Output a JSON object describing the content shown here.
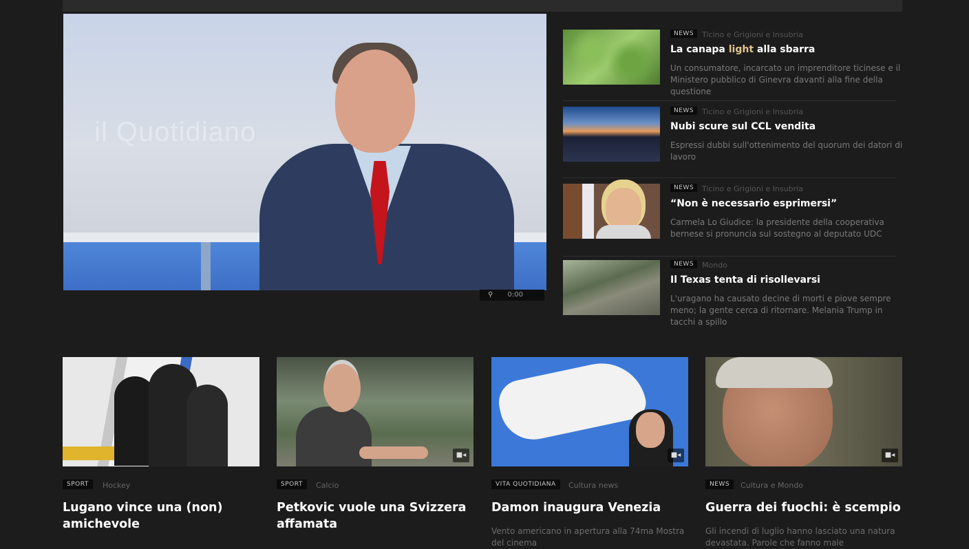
{
  "hero": {
    "studio_logo": "il Quotidiano",
    "player_label": "0:00"
  },
  "side_news": [
    {
      "tag": "NEWS",
      "meta": "Ticino e Grigioni e Insubria",
      "title_pre": "La canapa ",
      "title_hl": "light",
      "title_post": " alla sbarra",
      "desc": "Un consumatore, incarcato un imprenditore ticinese e il Ministero pubblico di Ginevra davanti alla fine della questione"
    },
    {
      "tag": "NEWS",
      "meta": "Ticino e Grigioni e Insubria",
      "title_pre": "Nubi scure sul CCL vendita",
      "title_hl": "",
      "title_post": "",
      "desc": "Espressi dubbi sull'ottenimento del quorum dei datori di lavoro"
    },
    {
      "tag": "NEWS",
      "meta": "Ticino e Grigioni e Insubria",
      "title_pre": "“Non è necessario esprimersi”",
      "title_hl": "",
      "title_post": "",
      "desc": "Carmela Lo Giudice: la presidente della cooperativa bernese si pronuncia sul sostegno al deputato UDC"
    },
    {
      "tag": "NEWS",
      "meta": "Mondo",
      "title_pre": "Il Texas tenta di risollevarsi",
      "title_hl": "",
      "title_post": "",
      "desc": "L'uragano ha causato decine di morti e piove sempre meno; la gente cerca di ritornare. Melania Trump in tacchi a spillo"
    }
  ],
  "cards": [
    {
      "tag": "SPORT",
      "meta": "Hockey",
      "title": "Lugano vince una (non) amichevole",
      "desc": ""
    },
    {
      "tag": "SPORT",
      "meta": "Calcio",
      "title": "Petkovic vuole una Svizzera affamata",
      "desc": ""
    },
    {
      "tag": "VITA QUOTIDIANA",
      "meta": "Cultura news",
      "title": "Damon inaugura Venezia",
      "desc": "Vento americano in apertura alla 74ma Mostra del cinema"
    },
    {
      "tag": "NEWS",
      "meta": "Cultura e Mondo",
      "title": "Guerra dei fuochi: è scempio",
      "desc": "Gli incendi di luglio hanno lasciato una natura devastata. Parole che fanno male"
    }
  ],
  "icons": {
    "video": "video-camera-icon",
    "zoom": "magnifier-icon"
  },
  "colors": {
    "background": "#1c1c1c",
    "title_highlight": "#e2c58e",
    "tag_bg": "#0b0b0b"
  }
}
